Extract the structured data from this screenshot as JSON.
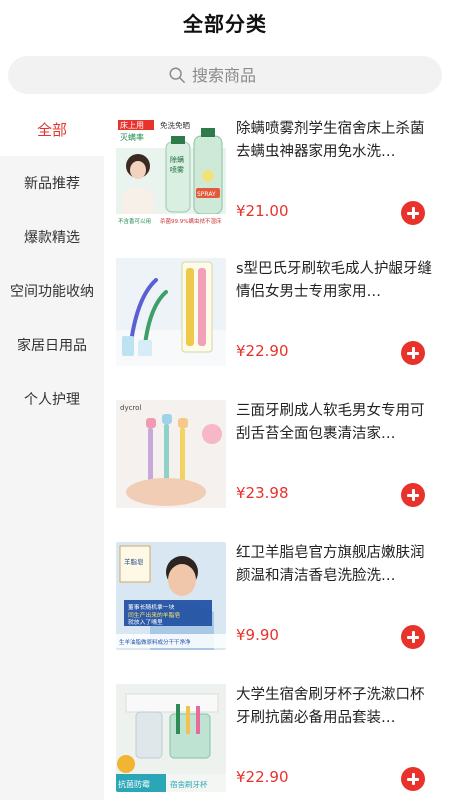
{
  "header": {
    "title": "全部分类"
  },
  "search": {
    "placeholder": "搜索商品"
  },
  "sidebar": {
    "items": [
      {
        "label": "全部",
        "active": true
      },
      {
        "label": "新品推荐",
        "active": false
      },
      {
        "label": "爆款精选",
        "active": false
      },
      {
        "label": "空间功能收纳",
        "active": false
      },
      {
        "label": "家居日用品",
        "active": false
      },
      {
        "label": "个人护理",
        "active": false
      }
    ]
  },
  "products": [
    {
      "title": "除螨喷雾剂学生宿舍床上杀菌去螨虫神器家用免水洗…",
      "price": "¥21.00",
      "image_text": [
        "床上用",
        "免洗免晒",
        "灭螨率",
        "除螨",
        "喷雾",
        "SPRAY",
        "不含香可以用",
        "杀菌99.9%螨虫祛不湿床"
      ]
    },
    {
      "title": "s型巴氏牙刷软毛成人护龈牙缝情侣女男士专用家用…",
      "price": "¥22.90",
      "image_text": []
    },
    {
      "title": "三面牙刷成人软毛男女专用可刮舌苔全面包裹清洁家…",
      "price": "¥23.98",
      "image_text": [
        "dycrol"
      ]
    },
    {
      "title": "红卫羊脂皂官方旗舰店嫩肤润颜温和清洁香皂洗脸洗…",
      "price": "¥9.90",
      "image_text": [
        "羊脂皂",
        "董事长随机拿一块",
        "同生产出来的羊脂皂",
        "就放入了嘴里",
        "生羊油脂做原料成分干干净净"
      ]
    },
    {
      "title": "大学生宿舍刷牙杯子洗漱口杯牙刷抗菌必备用品套装…",
      "price": "¥22.90",
      "image_text": [
        "抗菌防霉",
        "宿舍刷牙杯"
      ]
    }
  ],
  "colors": {
    "accent": "#e8322c",
    "sidebar_bg": "#f5f5f5",
    "search_bg": "#f2f2f2"
  },
  "icons": {
    "search": "search-icon",
    "add": "plus-circle-icon"
  }
}
